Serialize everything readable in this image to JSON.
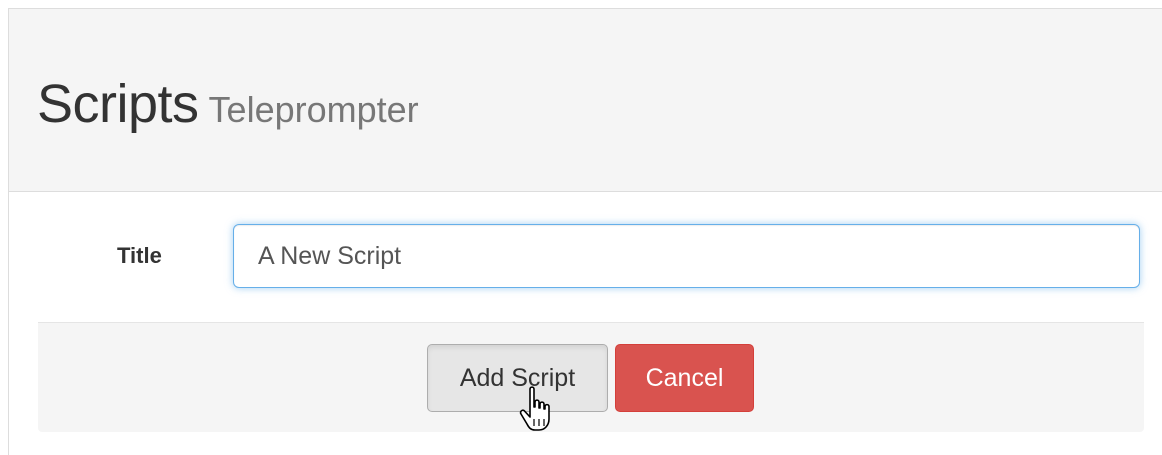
{
  "header": {
    "title": "Scripts",
    "subtitle": "Teleprompter"
  },
  "form": {
    "title_label": "Title",
    "title_value": "A New Script"
  },
  "actions": {
    "add_label": "Add Script",
    "cancel_label": "Cancel"
  },
  "colors": {
    "cancel_button": "#d9534f",
    "input_focus": "#66afe9",
    "panel_background": "#f5f5f5"
  },
  "pointer": {
    "icon": "hand-pointer-icon"
  }
}
